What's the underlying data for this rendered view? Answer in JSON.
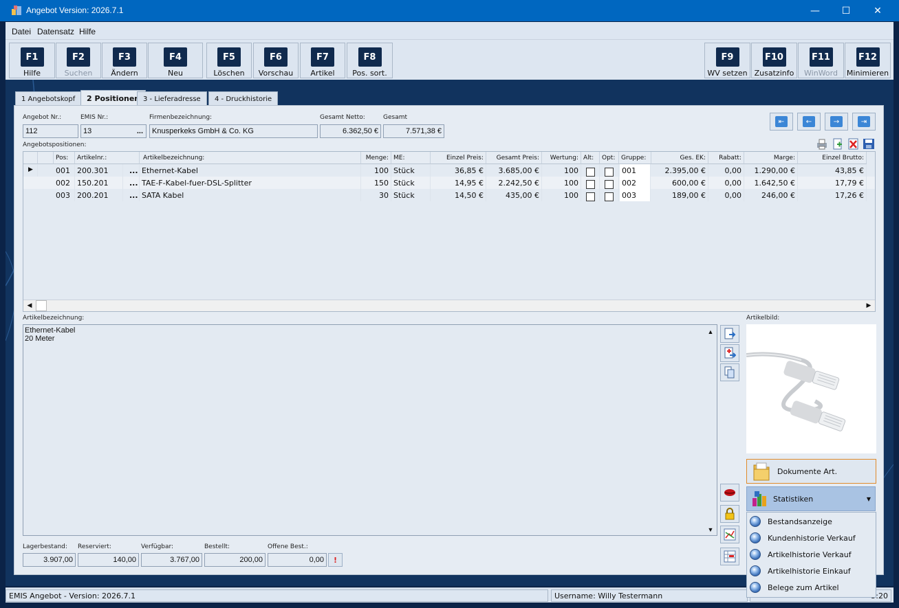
{
  "window": {
    "title": "Angebot Version: 2026.7.1",
    "minimize": "—",
    "maximize": "☐",
    "close": "✕"
  },
  "menu": [
    "Datei",
    "Datensatz",
    "Hilfe"
  ],
  "fkeys": [
    {
      "key": "F1",
      "label": "Hilfe"
    },
    {
      "key": "F2",
      "label": "Suchen"
    },
    {
      "key": "F3",
      "label": "Ändern"
    },
    {
      "key": "F4",
      "label": "Neu"
    },
    {
      "key": "F5",
      "label": "Löschen"
    },
    {
      "key": "F6",
      "label": "Vorschau"
    },
    {
      "key": "F7",
      "label": "Artikel"
    },
    {
      "key": "F8",
      "label": "Pos. sort."
    },
    {
      "key": "F9",
      "label": "WV setzen"
    },
    {
      "key": "F10",
      "label": "Zusatzinfo"
    },
    {
      "key": "F11",
      "label": "WinWord"
    },
    {
      "key": "F12",
      "label": "Minimieren"
    }
  ],
  "tabs": [
    "1 Angebotskopf",
    "2 Positionen",
    "3 - Lieferadresse",
    "4 - Druckhistorie"
  ],
  "header": {
    "angebot_nr_label": "Angebot Nr.:",
    "angebot_nr": "112",
    "emis_nr_label": "EMIS Nr.:",
    "emis_nr": "13",
    "emis_btn": "...",
    "firma_label": "Firmenbezeichnung:",
    "firma": "Knusperkeks GmbH & Co. KG",
    "netto_label": "Gesamt Netto:",
    "netto": "6.362,50 €",
    "gesamt_label": "Gesamt",
    "gesamt": "7.571,38 €"
  },
  "nav": [
    "⇤",
    "←",
    "→",
    "⇥"
  ],
  "positions_label": "Angebotspositionen:",
  "grid": {
    "columns": [
      "Pos:",
      "Artikelnr.:",
      "Artikelbezeichnung:",
      "Menge:",
      "ME:",
      "Einzel Preis:",
      "Gesamt Preis:",
      "Wertung:",
      "Alt:",
      "Opt:",
      "Gruppe:",
      "Ges. EK:",
      "Rabatt:",
      "Marge:",
      "Einzel Brutto:"
    ],
    "rows": [
      {
        "pos": "001",
        "artnr": "200.301",
        "dots": "...",
        "bez": "Ethernet-Kabel",
        "menge": "100",
        "me": "Stück",
        "einzel": "36,85 €",
        "gesamt": "3.685,00 €",
        "wertung": "100",
        "gruppe": "001",
        "ek": "2.395,00 €",
        "rabatt": "0,00",
        "marge": "1.290,00 €",
        "brutto": "43,85 €"
      },
      {
        "pos": "002",
        "artnr": "150.201",
        "dots": "...",
        "bez": "TAE-F-Kabel-fuer-DSL-Splitter",
        "menge": "150",
        "me": "Stück",
        "einzel": "14,95 €",
        "gesamt": "2.242,50 €",
        "wertung": "100",
        "gruppe": "002",
        "ek": "600,00 €",
        "rabatt": "0,00",
        "marge": "1.642,50 €",
        "brutto": "17,79 €"
      },
      {
        "pos": "003",
        "artnr": "200.201",
        "dots": "...",
        "bez": "SATA Kabel",
        "menge": "30",
        "me": "Stück",
        "einzel": "14,50 €",
        "gesamt": "435,00 €",
        "wertung": "100",
        "gruppe": "003",
        "ek": "189,00 €",
        "rabatt": "0,00",
        "marge": "246,00 €",
        "brutto": "17,26 €"
      }
    ]
  },
  "desc": {
    "label": "Artikelbezeichnung:",
    "line1": "Ethernet-Kabel",
    "line2": "20 Meter"
  },
  "stock": {
    "lager_label": "Lagerbestand:",
    "lager": "3.907,00",
    "res_label": "Reserviert:",
    "res": "140,00",
    "verf_label": "Verfügbar:",
    "verf": "3.767,00",
    "best_label": "Bestellt:",
    "best": "200,00",
    "offen_label": "Offene Best.:",
    "offen": "0,00"
  },
  "artikelbild_label": "Artikelbild:",
  "dokumente": "Dokumente Art.",
  "statistiken": "Statistiken",
  "dropdown": [
    "Bestandsanzeige",
    "Kundenhistorie Verkauf",
    "Artikelhistorie Verkauf",
    "Artikelhistorie Einkauf",
    "Belege zum Artikel"
  ],
  "status": {
    "left": "EMIS Angebot - Version: 2026.7.1",
    "user": "Username: Willy Testermann",
    "time": "5:20"
  }
}
